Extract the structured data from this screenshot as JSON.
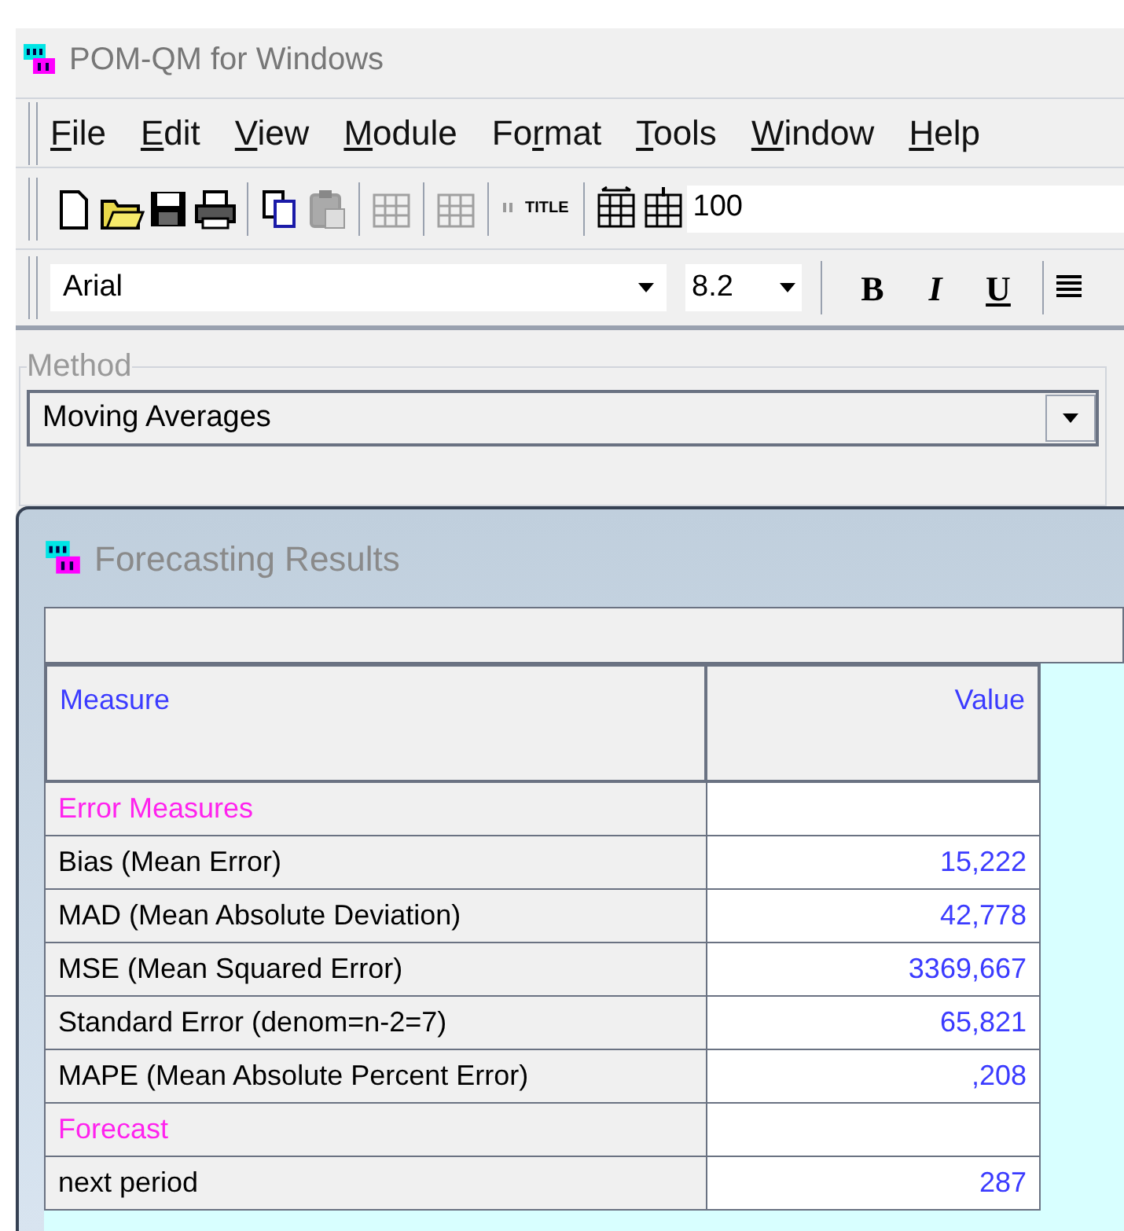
{
  "window": {
    "title": "POM-QM for Windows"
  },
  "menu": [
    {
      "key": "F",
      "after": "ile"
    },
    {
      "key": "E",
      "after": "dit"
    },
    {
      "key": "V",
      "after": "iew"
    },
    {
      "key": "M",
      "after": "odule"
    },
    {
      "before": "Fo",
      "key": "r",
      "after": "mat"
    },
    {
      "key": "T",
      "after": "ools"
    },
    {
      "key": "W",
      "after": "indow"
    },
    {
      "key": "H",
      "after": "elp"
    }
  ],
  "toolbar": [
    {
      "kind": "new",
      "disabled": false
    },
    {
      "kind": "open",
      "disabled": false
    },
    {
      "kind": "save",
      "disabled": false
    },
    {
      "kind": "print",
      "disabled": false
    },
    {
      "kind": "sep"
    },
    {
      "kind": "copy",
      "disabled": false
    },
    {
      "kind": "paste",
      "disabled": true
    },
    {
      "kind": "sep"
    },
    {
      "kind": "grid",
      "disabled": true
    },
    {
      "kind": "sep"
    },
    {
      "kind": "grid2",
      "disabled": true
    },
    {
      "kind": "sep"
    },
    {
      "kind": "pause",
      "disabled": true
    },
    {
      "kind": "title",
      "label": "TITLE",
      "disabled": false
    },
    {
      "kind": "sep"
    },
    {
      "kind": "cols",
      "disabled": false
    },
    {
      "kind": "rows",
      "disabled": false
    },
    {
      "kind": "zoom",
      "value": "100"
    }
  ],
  "format": {
    "font": "Arial",
    "size": "8.2",
    "bold": "B",
    "italic": "I",
    "underline": "U"
  },
  "method": {
    "legend": "Method",
    "value": "Moving Averages"
  },
  "results": {
    "title": "Forecasting Results",
    "columns": [
      "Measure",
      "Value"
    ],
    "rows": [
      {
        "kind": "section",
        "label": "Error Measures"
      },
      {
        "kind": "value",
        "label": "Bias (Mean Error)",
        "value": "15,222"
      },
      {
        "kind": "value",
        "label": "MAD (Mean Absolute Deviation)",
        "value": "42,778"
      },
      {
        "kind": "value",
        "label": "MSE (Mean Squared Error)",
        "value": "3369,667"
      },
      {
        "kind": "value",
        "label": "Standard Error (denom=n-2=7)",
        "value": "65,821"
      },
      {
        "kind": "value",
        "label": "MAPE (Mean Absolute Percent Error)",
        "value": ",208"
      },
      {
        "kind": "section",
        "label": "Forecast"
      },
      {
        "kind": "value",
        "label": "next period",
        "value": "287"
      }
    ]
  }
}
